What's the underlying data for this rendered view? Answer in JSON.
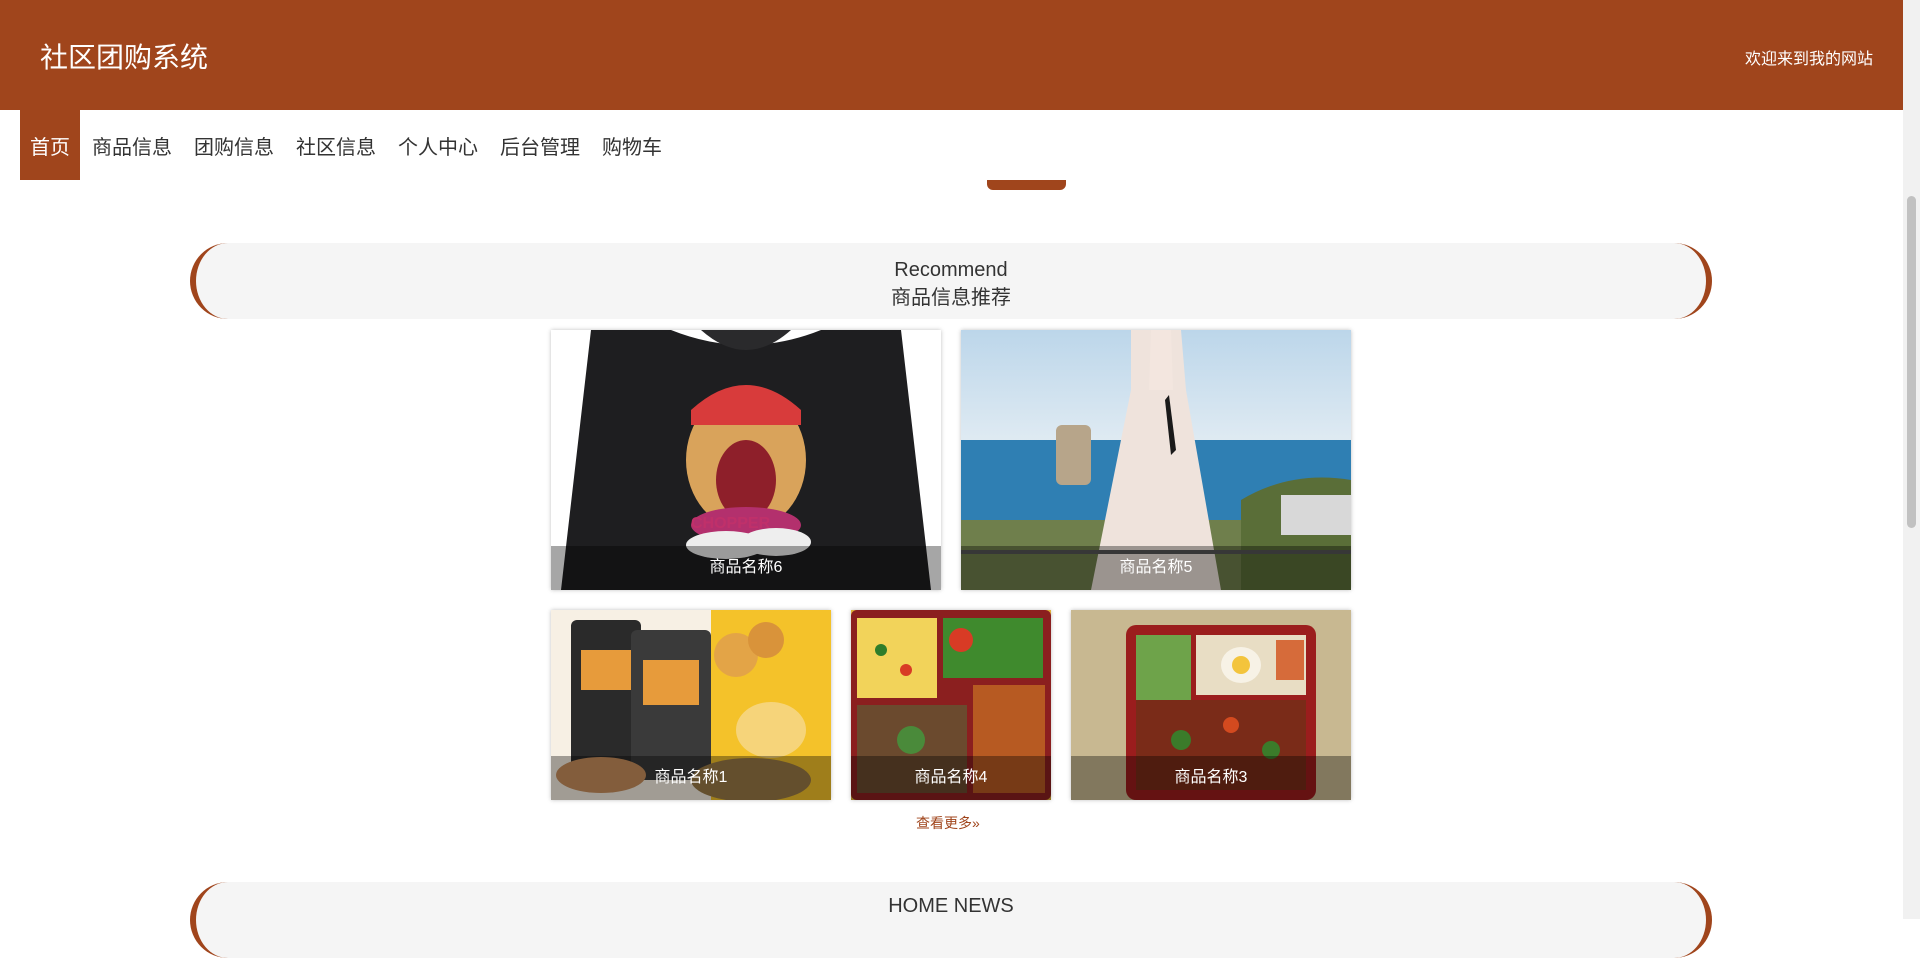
{
  "header": {
    "title": "社区团购系统",
    "welcome": "欢迎来到我的网站"
  },
  "nav": {
    "items": [
      "首页",
      "商品信息",
      "团购信息",
      "社区信息",
      "个人中心",
      "后台管理",
      "购物车"
    ]
  },
  "recommend": {
    "title_en": "Recommend",
    "title_zh": "商品信息推荐",
    "products": [
      {
        "name": "商品名称6",
        "image": "black-sweatshirt-chopper-print"
      },
      {
        "name": "商品名称5",
        "image": "white-lace-dress-seaside"
      },
      {
        "name": "商品名称1",
        "image": "snack-packages"
      },
      {
        "name": "商品名称4",
        "image": "boxed-meal-vegetables"
      },
      {
        "name": "商品名称3",
        "image": "boxed-meal-chicken-rice"
      }
    ],
    "more_label": "查看更多»"
  },
  "news": {
    "title_en": "HOME NEWS"
  },
  "colors": {
    "brand": "#a0451c",
    "section_bg": "#f5f5f5"
  }
}
